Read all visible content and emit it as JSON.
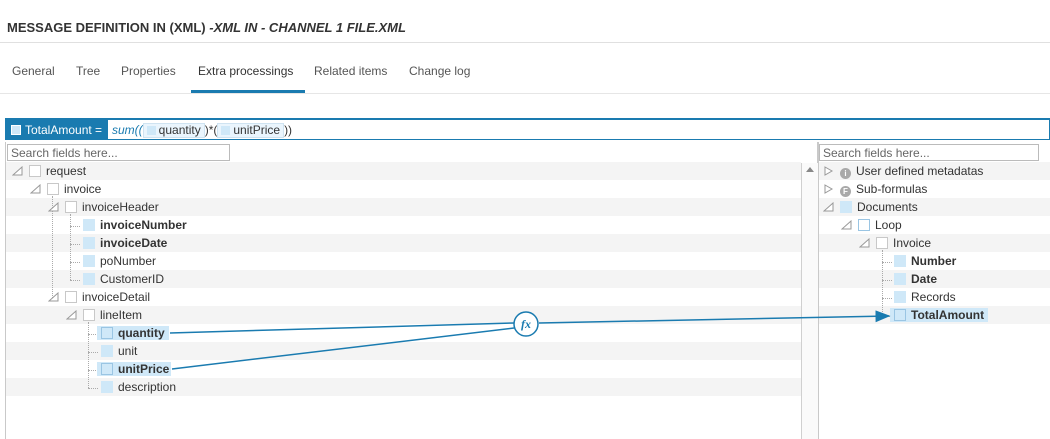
{
  "header": {
    "title_prefix": "MESSAGE DEFINITION IN (XML) ",
    "title_suffix": "-XML IN - CHANNEL 1 FILE.XML"
  },
  "tabs": [
    {
      "label": "General"
    },
    {
      "label": "Tree"
    },
    {
      "label": "Properties"
    },
    {
      "label": "Extra processings",
      "active": true
    },
    {
      "label": "Related items"
    },
    {
      "label": "Change log"
    }
  ],
  "formula": {
    "target": "TotalAmount =",
    "fn_open": "sum((",
    "arg1": "quantity",
    "mid": ")*(",
    "arg2": "unitPrice",
    "close": "))"
  },
  "left_tree": {
    "search_placeholder": "Search fields here...",
    "nodes": [
      {
        "label": "request"
      },
      {
        "label": "invoice"
      },
      {
        "label": "invoiceHeader"
      },
      {
        "label": "invoiceNumber"
      },
      {
        "label": "invoiceDate"
      },
      {
        "label": "poNumber"
      },
      {
        "label": "CustomerID"
      },
      {
        "label": "invoiceDetail"
      },
      {
        "label": "lineItem"
      },
      {
        "label": "quantity"
      },
      {
        "label": "unit"
      },
      {
        "label": "unitPrice"
      },
      {
        "label": "description"
      }
    ]
  },
  "right_tree": {
    "search_placeholder": "Search fields here...",
    "nodes": [
      {
        "label": "User defined metadatas",
        "icon": "info-icon",
        "glyph": "i"
      },
      {
        "label": "Sub-formulas",
        "icon": "formula-icon",
        "glyph": "F"
      },
      {
        "label": "Documents"
      },
      {
        "label": "Loop"
      },
      {
        "label": "Invoice"
      },
      {
        "label": "Number"
      },
      {
        "label": "Date"
      },
      {
        "label": "Records"
      },
      {
        "label": "TotalAmount"
      }
    ]
  },
  "mapping": {
    "function_glyph": "fx",
    "link_color": "#1a7bb0"
  }
}
